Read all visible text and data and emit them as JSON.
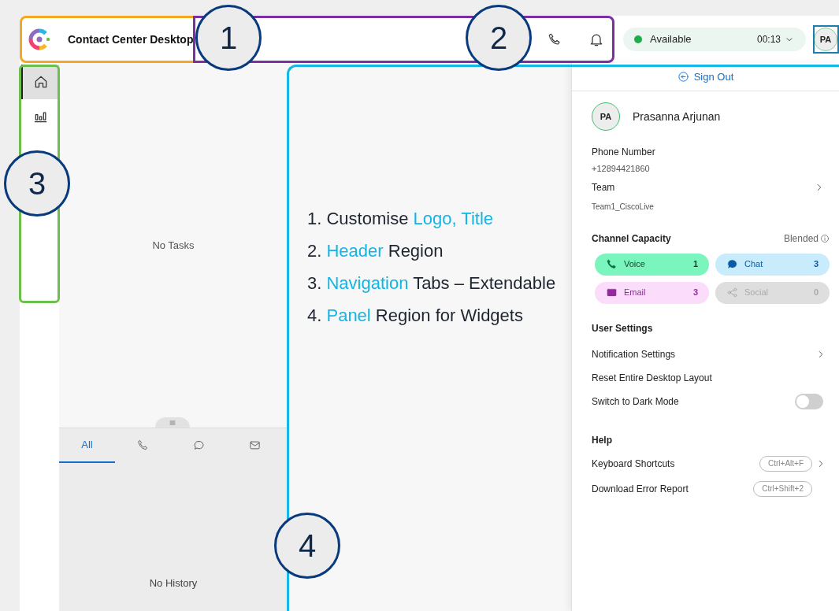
{
  "header": {
    "title": "Contact Center Desktop",
    "status": {
      "label": "Available",
      "timer": "00:13"
    },
    "avatar": "PA"
  },
  "navigation": [
    {
      "kind": "home",
      "selected": true
    },
    {
      "kind": "chart",
      "selected": false
    }
  ],
  "tasks": {
    "empty_text": "No Tasks"
  },
  "history": {
    "tabs": [
      {
        "kind": "text",
        "label": "All",
        "selected": true
      },
      {
        "kind": "phone",
        "selected": false
      },
      {
        "kind": "chat",
        "selected": false
      },
      {
        "kind": "email",
        "selected": false
      }
    ],
    "empty_text": "No History"
  },
  "notes": [
    {
      "number": "1.",
      "parts": [
        {
          "text": "Customise ",
          "highlight": false
        },
        {
          "text": "Logo, Title",
          "highlight": true
        }
      ]
    },
    {
      "number": "2.",
      "parts": [
        {
          "text": "Header",
          "highlight": true
        },
        {
          "text": " Region",
          "highlight": false
        }
      ]
    },
    {
      "number": "3.",
      "parts": [
        {
          "text": "Navigation",
          "highlight": true
        },
        {
          "text": " Tabs – Extendable",
          "highlight": false
        }
      ]
    },
    {
      "number": "4.",
      "parts": [
        {
          "text": "Panel",
          "highlight": true
        },
        {
          "text": " Region for Widgets",
          "highlight": false
        }
      ]
    }
  ],
  "profile": {
    "sign_out": "Sign Out",
    "avatar": "PA",
    "name": "Prasanna Arjunan",
    "phone_label": "Phone Number",
    "phone": "+12894421860",
    "team_label": "Team",
    "team": "Team1_CiscoLive",
    "capacity_label": "Channel Capacity",
    "capacity_mode": "Blended",
    "channels": [
      {
        "kind": "voice",
        "label": "Voice",
        "count": "1"
      },
      {
        "kind": "chat",
        "label": "Chat",
        "count": "3"
      },
      {
        "kind": "email",
        "label": "Email",
        "count": "3"
      },
      {
        "kind": "social",
        "label": "Social",
        "count": "0"
      }
    ],
    "user_settings_label": "User Settings",
    "settings": [
      {
        "kind": "link",
        "label": "Notification Settings"
      },
      {
        "kind": "plain",
        "label": "Reset Entire Desktop Layout"
      },
      {
        "kind": "toggle",
        "label": "Switch to Dark Mode",
        "on": false
      }
    ],
    "help_label": "Help",
    "help": [
      {
        "label": "Keyboard Shortcuts",
        "shortcut": "Ctrl+Alt+F",
        "chevron": true
      },
      {
        "label": "Download Error Report",
        "shortcut": "Ctrl+Shift+2",
        "chevron": false
      }
    ]
  },
  "callouts": [
    {
      "label": "1",
      "color": "#f5a623"
    },
    {
      "label": "2",
      "color": "#7b2fa0"
    },
    {
      "label": "3",
      "color": "#6cbf4a"
    },
    {
      "label": "4",
      "color": "#14b8e6"
    }
  ]
}
